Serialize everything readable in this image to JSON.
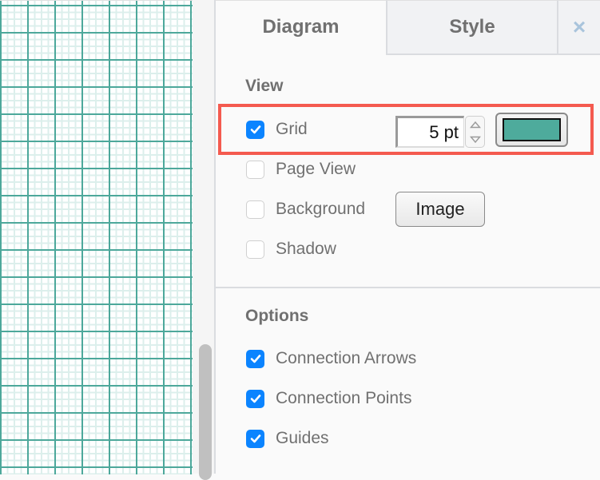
{
  "tabs": {
    "diagram": "Diagram",
    "style": "Style",
    "close_icon": "×"
  },
  "view": {
    "title": "View",
    "grid": {
      "label": "Grid",
      "checked": true,
      "size_value": "5 pt",
      "color": "#4eab9c"
    },
    "page_view": {
      "label": "Page View",
      "checked": false
    },
    "background": {
      "label": "Background",
      "checked": false,
      "image_button": "Image"
    },
    "shadow": {
      "label": "Shadow",
      "checked": false
    }
  },
  "options": {
    "title": "Options",
    "items": [
      {
        "label": "Connection Arrows",
        "checked": true
      },
      {
        "label": "Connection Points",
        "checked": true
      },
      {
        "label": "Guides",
        "checked": true
      }
    ]
  },
  "colors": {
    "accent": "#0b84ff",
    "highlight": "#f45a4f",
    "grid_major": "#4da89b",
    "grid_minor": "#dcefec"
  }
}
